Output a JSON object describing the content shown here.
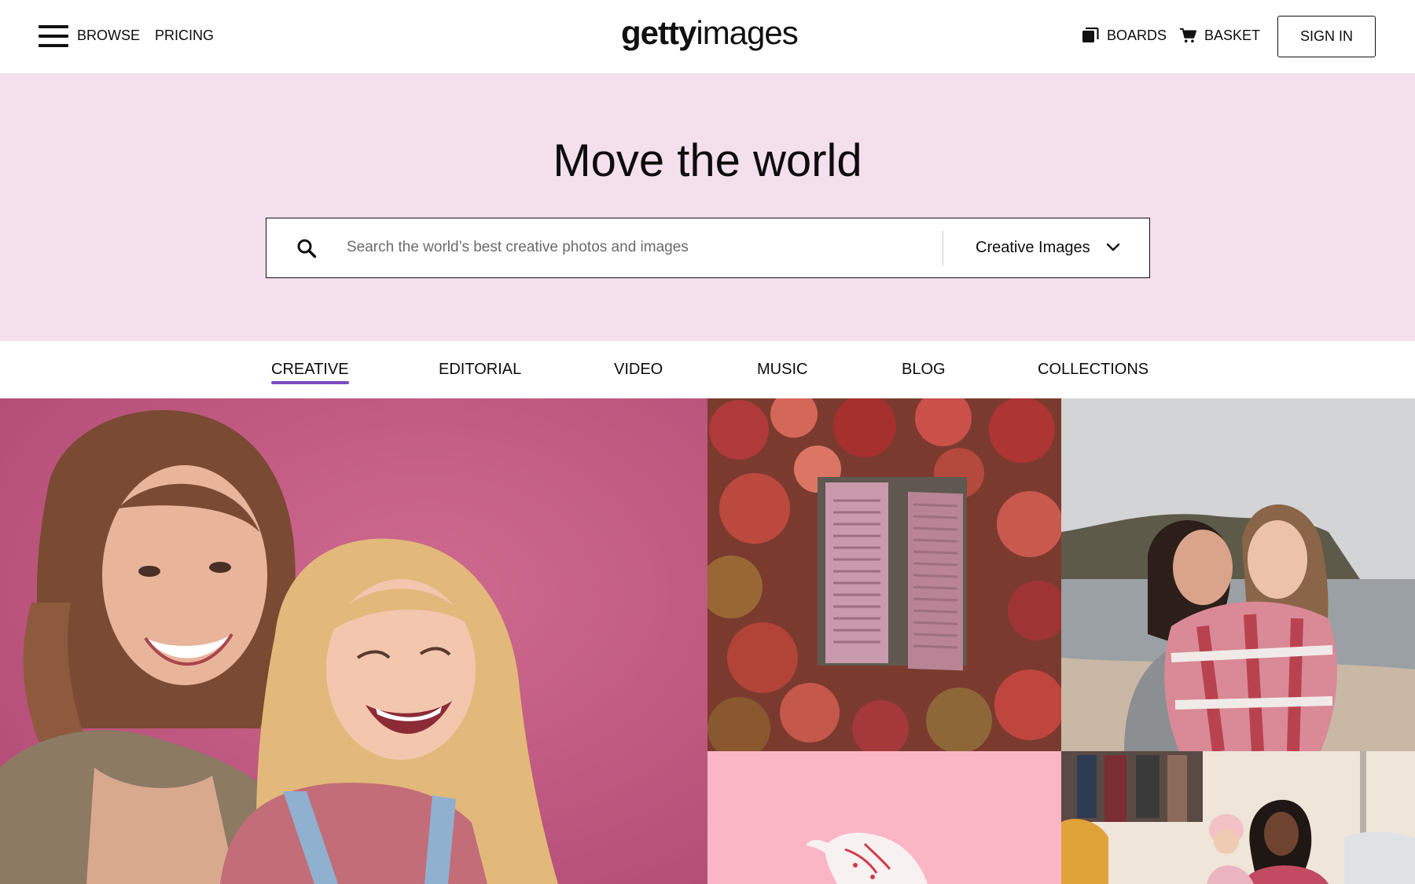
{
  "header": {
    "browse_label": "BROWSE",
    "pricing_label": "PRICING",
    "logo_bold": "getty",
    "logo_light": "images",
    "boards_label": "BOARDS",
    "basket_label": "BASKET",
    "signin_label": "SIGN IN"
  },
  "hero": {
    "title": "Move the world",
    "search_placeholder": "Search the world’s best creative photos and images",
    "search_value": "",
    "type_selected": "Creative Images",
    "background_color": "#f4dfec"
  },
  "tabs": [
    {
      "label": "CREATIVE",
      "active": true
    },
    {
      "label": "EDITORIAL",
      "active": false
    },
    {
      "label": "VIDEO",
      "active": false
    },
    {
      "label": "MUSIC",
      "active": false
    },
    {
      "label": "BLOG",
      "active": false
    },
    {
      "label": "COLLECTIONS",
      "active": false
    }
  ],
  "active_tab_color": "#7b4bc2",
  "gallery": [
    {
      "name": "mother-and-daughter-photo"
    },
    {
      "name": "ivy-window-shutters-photo"
    },
    {
      "name": "friends-hugging-on-beach-photo"
    },
    {
      "name": "pink-illustration-tile"
    },
    {
      "name": "market-family-photo"
    }
  ]
}
